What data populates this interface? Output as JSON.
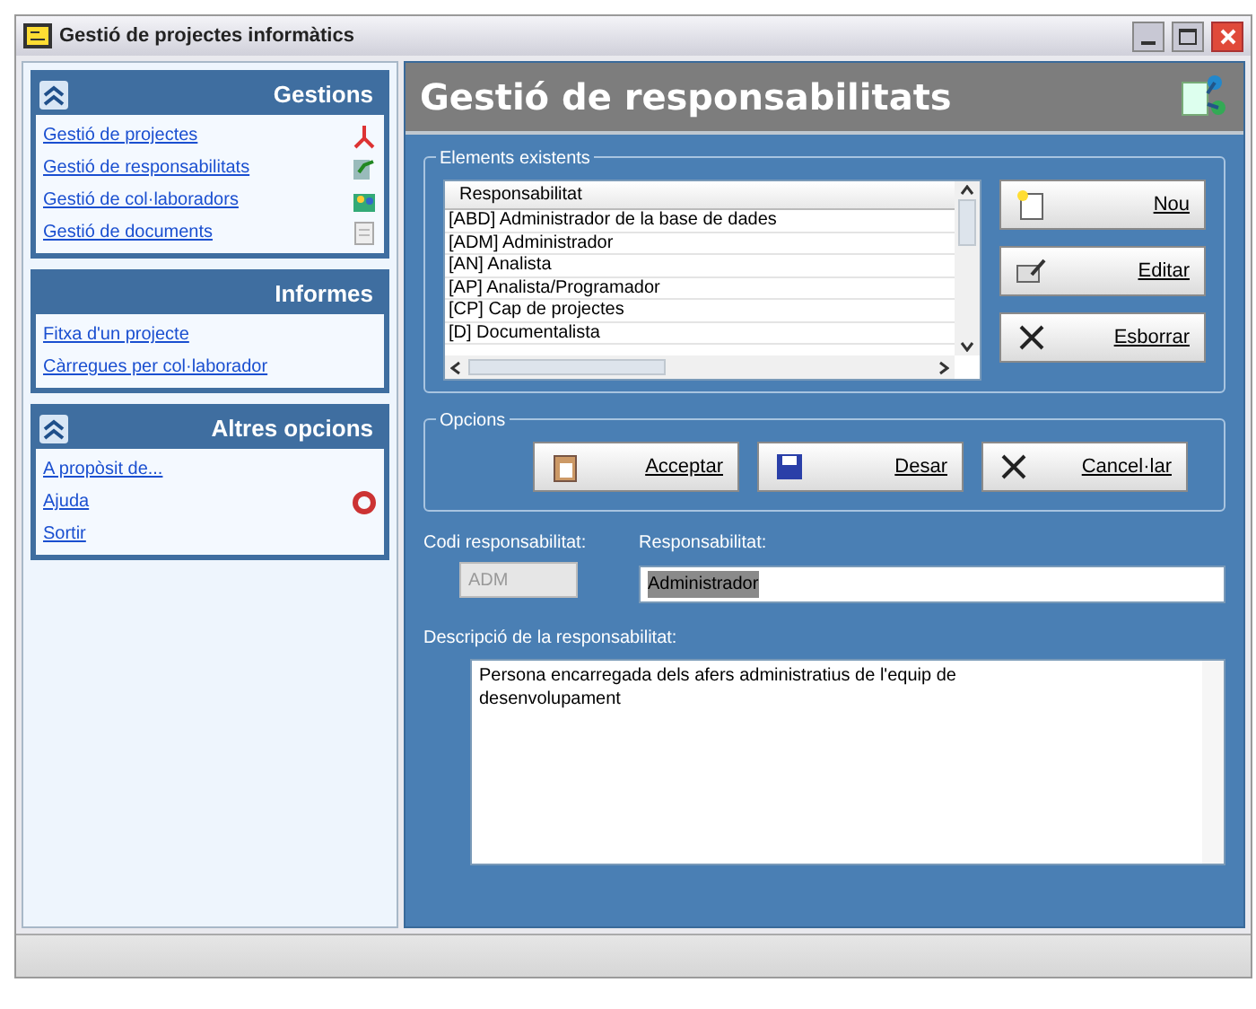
{
  "window": {
    "title": "Gestió de projectes informàtics"
  },
  "sidebar": {
    "sections": [
      {
        "title": "Gestions",
        "collapsible": true,
        "items": [
          "Gestió de projectes",
          "Gestió de responsabilitats",
          "Gestió de col·laboradors",
          "Gestió de documents"
        ]
      },
      {
        "title": "Informes",
        "collapsible": false,
        "items": [
          "Fitxa d'un projecte",
          "Càrregues per col·laborador"
        ]
      },
      {
        "title": "Altres opcions",
        "collapsible": true,
        "items": [
          "A propòsit de...",
          "Ajuda",
          "Sortir"
        ]
      }
    ]
  },
  "header": {
    "title": "Gestió de responsabilitats"
  },
  "existing": {
    "label": "Elements existents",
    "column": "Responsabilitat",
    "rows": [
      "[ABD] Administrador de la base de dades",
      "[ADM] Administrador",
      "[AN] Analista",
      "[AP] Analista/Programador",
      "[CP] Cap de projectes",
      "[D] Documentalista"
    ],
    "buttons": [
      "Nou",
      "Editar",
      "Esborrar"
    ]
  },
  "options": {
    "label": "Opcions",
    "buttons": [
      "Acceptar",
      "Desar",
      "Cancel·lar"
    ]
  },
  "form": {
    "code": {
      "label": "Codi responsabilitat:",
      "value": "ADM",
      "disabled": true
    },
    "name": {
      "label": "Responsabilitat:",
      "value": "Administrador",
      "highlighted": true
    },
    "description": {
      "label": "Descripció de la responsabilitat:",
      "value": "Persona encarregada dels afers administratius de l'equip de desenvolupament"
    }
  }
}
